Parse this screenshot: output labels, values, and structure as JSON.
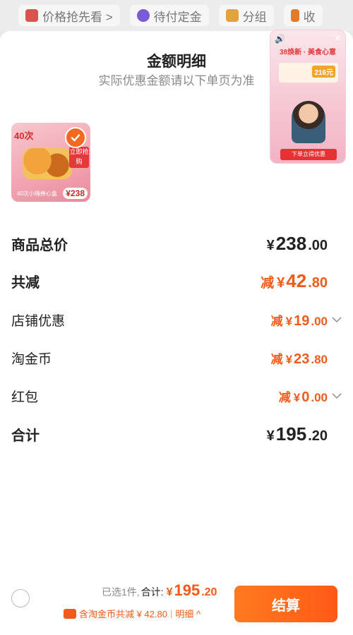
{
  "topbar": {
    "items": [
      "价格抢先看 >",
      "待付定金",
      "分组",
      "收"
    ]
  },
  "sheet": {
    "title": "金额明细",
    "subtitle": "实际优惠金额请以下单页为准"
  },
  "product": {
    "badge": "40次",
    "buy_label": "立即抢购",
    "price_tag": "¥238",
    "caption": "40次小嗨捧心盒"
  },
  "video": {
    "headline": "38焕新 · 美食心意",
    "price": "216元",
    "footer": "下单立得优惠"
  },
  "rows": {
    "subtotal": {
      "label": "商品总价",
      "currency": "¥",
      "int": "238",
      "dec": ".00"
    },
    "total_discount": {
      "label": "共减",
      "minus": "减",
      "currency": "¥",
      "int": "42",
      "dec": ".80"
    },
    "shop_discount": {
      "label": "店铺优惠",
      "minus": "减",
      "currency": "¥",
      "int": "19",
      "dec": ".00"
    },
    "coins": {
      "label": "淘金币",
      "minus": "减",
      "currency": "¥",
      "int": "23",
      "dec": ".80"
    },
    "red_packet": {
      "label": "红包",
      "minus": "减",
      "currency": "¥",
      "int": "0",
      "dec": ".00"
    },
    "total": {
      "label": "合计",
      "currency": "¥",
      "int": "195",
      "dec": ".20"
    }
  },
  "bottom": {
    "selected": "已选1件,",
    "total_label": "合计:",
    "currency": "¥",
    "int": "195",
    "dec": ".20",
    "coin_text": "含淘金币共减 ¥ 42.80",
    "sep": "|",
    "detail": "明细 ^",
    "checkout": "结算"
  },
  "colors": {
    "accent": "#f25a1a",
    "checkout_from": "#ff7a1e",
    "checkout_to": "#ff5a16"
  }
}
